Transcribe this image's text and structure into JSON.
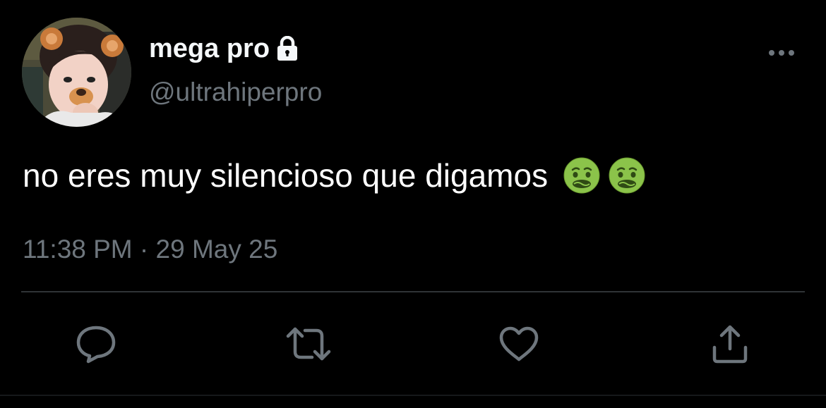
{
  "user": {
    "display_name": "mega pro",
    "handle": "@ultrahiperpro",
    "protected_icon": "lock-icon",
    "avatar_icon": "avatar-photo"
  },
  "tweet": {
    "text": "no eres muy silencioso que digamos",
    "emojis": [
      "nauseated-face-emoji",
      "nauseated-face-emoji"
    ],
    "timestamp": "11:38 PM · 29 May 25"
  },
  "actions": {
    "reply_icon": "reply-icon",
    "retweet_icon": "retweet-icon",
    "like_icon": "heart-icon",
    "share_icon": "share-icon",
    "more_icon": "more-icon"
  },
  "colors": {
    "background": "#000000",
    "primary_text": "#ffffff",
    "secondary_text": "#6e767d",
    "divider": "#2f3336",
    "emoji_green": "#8bc34a"
  }
}
